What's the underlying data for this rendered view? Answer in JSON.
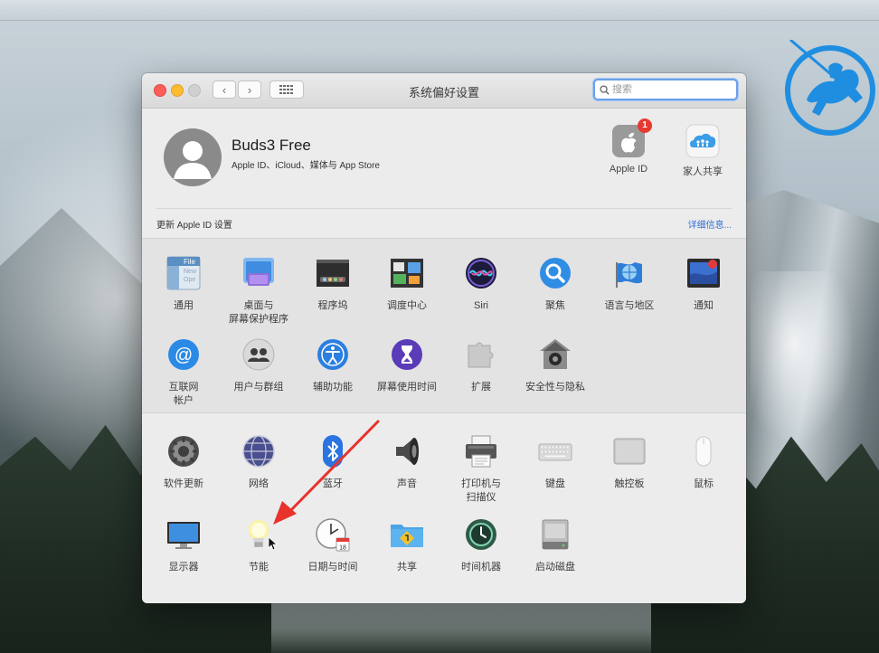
{
  "window": {
    "title": "系统偏好设置",
    "search_placeholder": "搜索"
  },
  "account": {
    "name": "Buds3 Free",
    "subtitle": "Apple ID、iCloud、媒体与 App Store",
    "tiles": [
      {
        "label": "Apple ID",
        "icon": "apple-id-icon",
        "badge": "1"
      },
      {
        "label": "家人共享",
        "icon": "family-sharing-icon"
      }
    ]
  },
  "notice": {
    "text": "更新 Apple ID 设置",
    "link": "详细信息..."
  },
  "panes_row1": [
    {
      "label": "通用",
      "icon": "general-icon"
    },
    {
      "label": "桌面与\n屏幕保护程序",
      "icon": "desktop-screensaver-icon"
    },
    {
      "label": "程序坞",
      "icon": "dock-icon"
    },
    {
      "label": "调度中心",
      "icon": "mission-control-icon"
    },
    {
      "label": "Siri",
      "icon": "siri-icon"
    },
    {
      "label": "聚焦",
      "icon": "spotlight-icon"
    },
    {
      "label": "语言与地区",
      "icon": "language-region-icon"
    },
    {
      "label": "通知",
      "icon": "notifications-icon"
    }
  ],
  "panes_row2": [
    {
      "label": "互联网\n帐户",
      "icon": "internet-accounts-icon"
    },
    {
      "label": "用户与群组",
      "icon": "users-groups-icon"
    },
    {
      "label": "辅助功能",
      "icon": "accessibility-icon"
    },
    {
      "label": "屏幕使用时间",
      "icon": "screen-time-icon"
    },
    {
      "label": "扩展",
      "icon": "extensions-icon"
    },
    {
      "label": "安全性与隐私",
      "icon": "security-privacy-icon"
    }
  ],
  "panes_row3": [
    {
      "label": "软件更新",
      "icon": "software-update-icon"
    },
    {
      "label": "网络",
      "icon": "network-icon"
    },
    {
      "label": "蓝牙",
      "icon": "bluetooth-icon"
    },
    {
      "label": "声音",
      "icon": "sound-icon"
    },
    {
      "label": "打印机与\n扫描仪",
      "icon": "printers-scanners-icon"
    },
    {
      "label": "键盘",
      "icon": "keyboard-icon"
    },
    {
      "label": "触控板",
      "icon": "trackpad-icon"
    },
    {
      "label": "鼠标",
      "icon": "mouse-icon"
    }
  ],
  "panes_row4": [
    {
      "label": "显示器",
      "icon": "displays-icon"
    },
    {
      "label": "节能",
      "icon": "energy-saver-icon"
    },
    {
      "label": "日期与时间",
      "icon": "date-time-icon"
    },
    {
      "label": "共享",
      "icon": "sharing-icon"
    },
    {
      "label": "时间机器",
      "icon": "time-machine-icon"
    },
    {
      "label": "启动磁盘",
      "icon": "startup-disk-icon"
    }
  ],
  "date_icon_day": "18",
  "colors": {
    "accent": "#2f6fd6",
    "annotation_arrow": "#e8322b",
    "badge": "#e63a31"
  }
}
